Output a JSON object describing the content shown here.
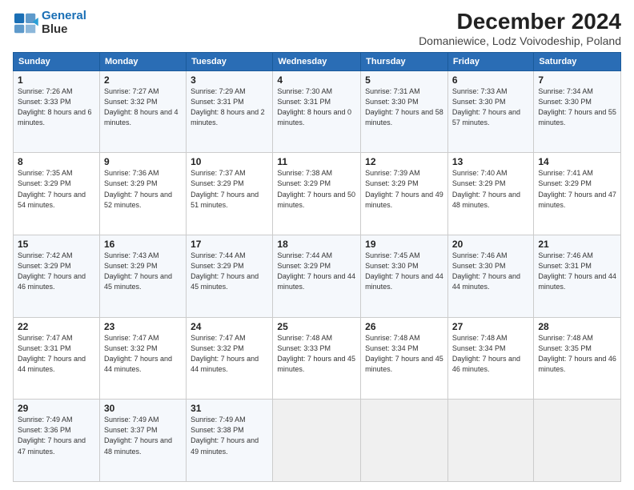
{
  "logo": {
    "line1": "General",
    "line2": "Blue"
  },
  "title": "December 2024",
  "subtitle": "Domaniewice, Lodz Voivodeship, Poland",
  "days_header": [
    "Sunday",
    "Monday",
    "Tuesday",
    "Wednesday",
    "Thursday",
    "Friday",
    "Saturday"
  ],
  "weeks": [
    [
      {
        "num": "1",
        "rise": "7:26 AM",
        "set": "3:33 PM",
        "daylight": "8 hours and 6 minutes."
      },
      {
        "num": "2",
        "rise": "7:27 AM",
        "set": "3:32 PM",
        "daylight": "8 hours and 4 minutes."
      },
      {
        "num": "3",
        "rise": "7:29 AM",
        "set": "3:31 PM",
        "daylight": "8 hours and 2 minutes."
      },
      {
        "num": "4",
        "rise": "7:30 AM",
        "set": "3:31 PM",
        "daylight": "8 hours and 0 minutes."
      },
      {
        "num": "5",
        "rise": "7:31 AM",
        "set": "3:30 PM",
        "daylight": "7 hours and 58 minutes."
      },
      {
        "num": "6",
        "rise": "7:33 AM",
        "set": "3:30 PM",
        "daylight": "7 hours and 57 minutes."
      },
      {
        "num": "7",
        "rise": "7:34 AM",
        "set": "3:30 PM",
        "daylight": "7 hours and 55 minutes."
      }
    ],
    [
      {
        "num": "8",
        "rise": "7:35 AM",
        "set": "3:29 PM",
        "daylight": "7 hours and 54 minutes."
      },
      {
        "num": "9",
        "rise": "7:36 AM",
        "set": "3:29 PM",
        "daylight": "7 hours and 52 minutes."
      },
      {
        "num": "10",
        "rise": "7:37 AM",
        "set": "3:29 PM",
        "daylight": "7 hours and 51 minutes."
      },
      {
        "num": "11",
        "rise": "7:38 AM",
        "set": "3:29 PM",
        "daylight": "7 hours and 50 minutes."
      },
      {
        "num": "12",
        "rise": "7:39 AM",
        "set": "3:29 PM",
        "daylight": "7 hours and 49 minutes."
      },
      {
        "num": "13",
        "rise": "7:40 AM",
        "set": "3:29 PM",
        "daylight": "7 hours and 48 minutes."
      },
      {
        "num": "14",
        "rise": "7:41 AM",
        "set": "3:29 PM",
        "daylight": "7 hours and 47 minutes."
      }
    ],
    [
      {
        "num": "15",
        "rise": "7:42 AM",
        "set": "3:29 PM",
        "daylight": "7 hours and 46 minutes."
      },
      {
        "num": "16",
        "rise": "7:43 AM",
        "set": "3:29 PM",
        "daylight": "7 hours and 45 minutes."
      },
      {
        "num": "17",
        "rise": "7:44 AM",
        "set": "3:29 PM",
        "daylight": "7 hours and 45 minutes."
      },
      {
        "num": "18",
        "rise": "7:44 AM",
        "set": "3:29 PM",
        "daylight": "7 hours and 44 minutes."
      },
      {
        "num": "19",
        "rise": "7:45 AM",
        "set": "3:30 PM",
        "daylight": "7 hours and 44 minutes."
      },
      {
        "num": "20",
        "rise": "7:46 AM",
        "set": "3:30 PM",
        "daylight": "7 hours and 44 minutes."
      },
      {
        "num": "21",
        "rise": "7:46 AM",
        "set": "3:31 PM",
        "daylight": "7 hours and 44 minutes."
      }
    ],
    [
      {
        "num": "22",
        "rise": "7:47 AM",
        "set": "3:31 PM",
        "daylight": "7 hours and 44 minutes."
      },
      {
        "num": "23",
        "rise": "7:47 AM",
        "set": "3:32 PM",
        "daylight": "7 hours and 44 minutes."
      },
      {
        "num": "24",
        "rise": "7:47 AM",
        "set": "3:32 PM",
        "daylight": "7 hours and 44 minutes."
      },
      {
        "num": "25",
        "rise": "7:48 AM",
        "set": "3:33 PM",
        "daylight": "7 hours and 45 minutes."
      },
      {
        "num": "26",
        "rise": "7:48 AM",
        "set": "3:34 PM",
        "daylight": "7 hours and 45 minutes."
      },
      {
        "num": "27",
        "rise": "7:48 AM",
        "set": "3:34 PM",
        "daylight": "7 hours and 46 minutes."
      },
      {
        "num": "28",
        "rise": "7:48 AM",
        "set": "3:35 PM",
        "daylight": "7 hours and 46 minutes."
      }
    ],
    [
      {
        "num": "29",
        "rise": "7:49 AM",
        "set": "3:36 PM",
        "daylight": "7 hours and 47 minutes."
      },
      {
        "num": "30",
        "rise": "7:49 AM",
        "set": "3:37 PM",
        "daylight": "7 hours and 48 minutes."
      },
      {
        "num": "31",
        "rise": "7:49 AM",
        "set": "3:38 PM",
        "daylight": "7 hours and 49 minutes."
      },
      null,
      null,
      null,
      null
    ]
  ]
}
